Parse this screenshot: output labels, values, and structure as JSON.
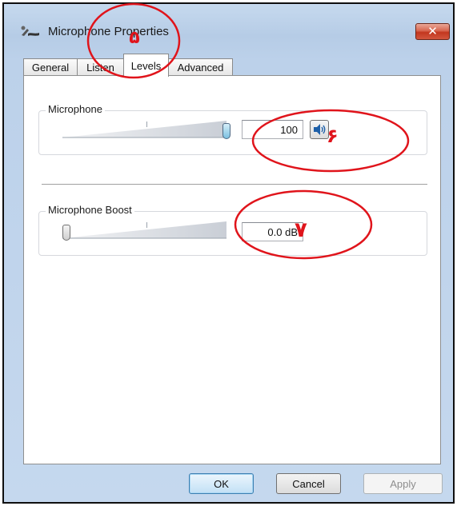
{
  "window": {
    "title": "Microphone Properties",
    "close_glyph": "✕"
  },
  "tabs": [
    {
      "label": "General",
      "active": false
    },
    {
      "label": "Listen",
      "active": false
    },
    {
      "label": "Levels",
      "active": true
    },
    {
      "label": "Advanced",
      "active": false
    }
  ],
  "levels": {
    "microphone": {
      "label": "Microphone",
      "value": "100",
      "level_fraction": 1.0,
      "speaker_icon": "speaker-volume-icon"
    },
    "boost": {
      "label": "Microphone Boost",
      "value": "0.0 dB",
      "level_fraction": 0.0
    }
  },
  "buttons": {
    "ok": "OK",
    "cancel": "Cancel",
    "apply": "Apply"
  },
  "annotations": {
    "marker_5": "۵",
    "marker_6": "۶",
    "marker_7": "۷",
    "color": "#e0141b"
  },
  "colors": {
    "window_frame": "#bcd1ea",
    "close_button": "#c2371f",
    "thumb_blue": "#7cc0e0"
  }
}
